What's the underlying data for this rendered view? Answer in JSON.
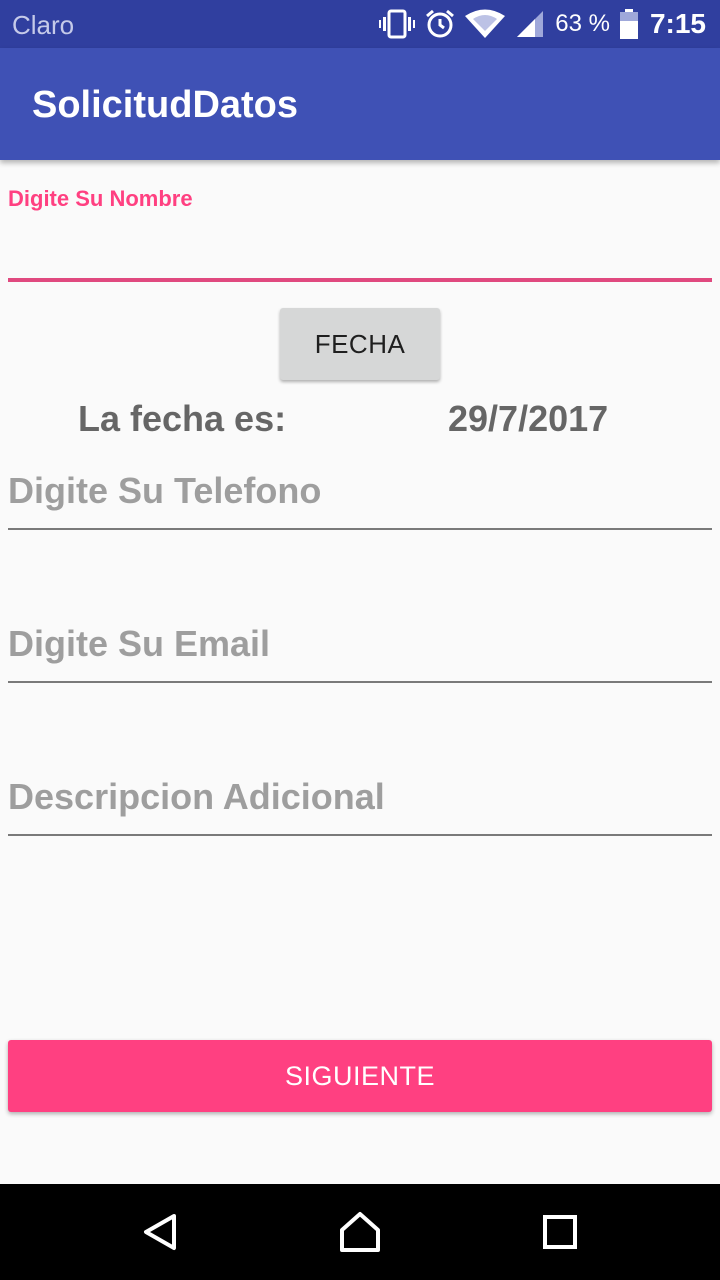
{
  "status_bar": {
    "carrier": "Claro",
    "battery_percent": "63 %",
    "time": "7:15",
    "icons": [
      "vibrate-icon",
      "alarm-icon",
      "wifi-icon",
      "signal-icon",
      "battery-icon"
    ]
  },
  "app_bar": {
    "title": "SolicitudDatos"
  },
  "form": {
    "nombre": {
      "label": "Digite Su Nombre",
      "value": ""
    },
    "fecha_button": "FECHA",
    "fecha_label": "La fecha es:",
    "fecha_value": "29/7/2017",
    "telefono": {
      "placeholder": "Digite Su Telefono"
    },
    "email": {
      "placeholder": "Digite Su Email"
    },
    "descripcion": {
      "placeholder": "Descripcion Adicional"
    },
    "siguiente_button": "SIGUIENTE"
  },
  "colors": {
    "primary": "#3f51b5",
    "primary_dark": "#303f9f",
    "accent": "#ff4081"
  },
  "nav_bar": {
    "icons": [
      "back-icon",
      "home-icon",
      "recents-icon"
    ]
  }
}
